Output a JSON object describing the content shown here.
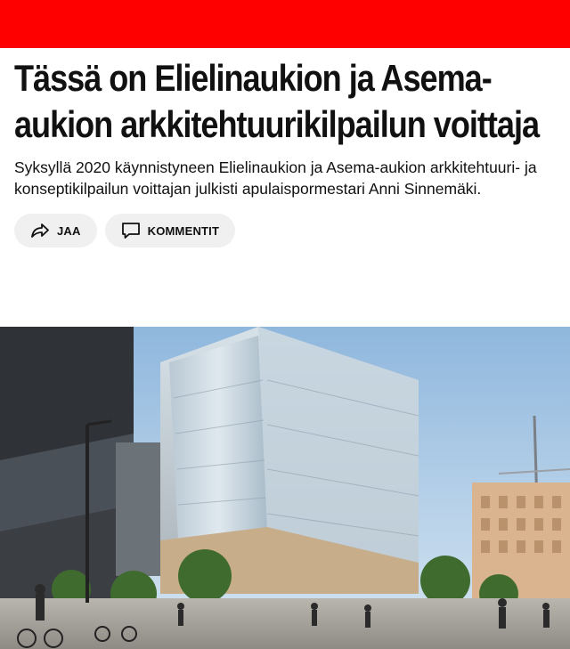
{
  "site": {
    "brand_color": "#ff0000"
  },
  "article": {
    "title": "Tässä on Elielinaukion ja Asema-aukion arkkitehtuurikilpailun voittaja",
    "lead": "Syksyllä 2020 käynnistyneen Elielinaukion ja Asema-aukion arkkitehtuuri- ja konseptikilpailun voittajan julkisti apulaisp­ormestari Anni Sinnemäki."
  },
  "actions": {
    "share_label": "JAA",
    "share_icon": "share-arrow-icon",
    "comment_label": "KOMMENTIT",
    "comment_icon": "comment-bubble-icon"
  },
  "hero_image": {
    "description_icon": "architecture-render"
  }
}
